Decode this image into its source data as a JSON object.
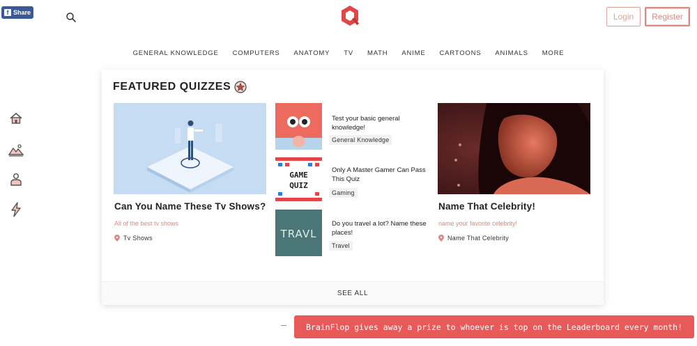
{
  "header": {
    "share_label": "Share",
    "login_label": "Login",
    "register_label": "Register"
  },
  "nav": {
    "items": [
      "GENERAL KNOWLEDGE",
      "COMPUTERS",
      "ANATOMY",
      "TV",
      "MATH",
      "ANIME",
      "CARTOONS",
      "ANIMALS",
      "MORE"
    ]
  },
  "sidebar": {
    "icons": [
      "home-icon",
      "landscape-icon",
      "profile-icon",
      "lightning-icon"
    ]
  },
  "featured": {
    "title": "FEATURED QUIZZES",
    "left": {
      "title": "Can You Name These Tv Shows?",
      "description": "All of the best tv shows",
      "category": "Tv Shows"
    },
    "middle": [
      {
        "title": "Test your basic general knowledge!",
        "tag": "General Knowledge"
      },
      {
        "title": "Only A Master Gamer Can Pass This Quiz",
        "tag": "Gaming",
        "thumb_text_1": "GAME",
        "thumb_text_2": "QUIZ"
      },
      {
        "title": "Do you travel a lot? Name these places!",
        "tag": "Travel",
        "thumb_text": "TRAVL"
      }
    ],
    "right": {
      "title": "Name That Celebrity!",
      "description": "name your favorite celebrity!",
      "category": "Name That Celebrity"
    },
    "see_all_label": "SEE ALL"
  },
  "banner": {
    "text": "BrainFlop gives away a prize to whoever is top on the Leaderboard every month!"
  },
  "colors": {
    "accent": "#d9897f",
    "banner": "#e85a5a",
    "facebook": "#3b5998"
  }
}
